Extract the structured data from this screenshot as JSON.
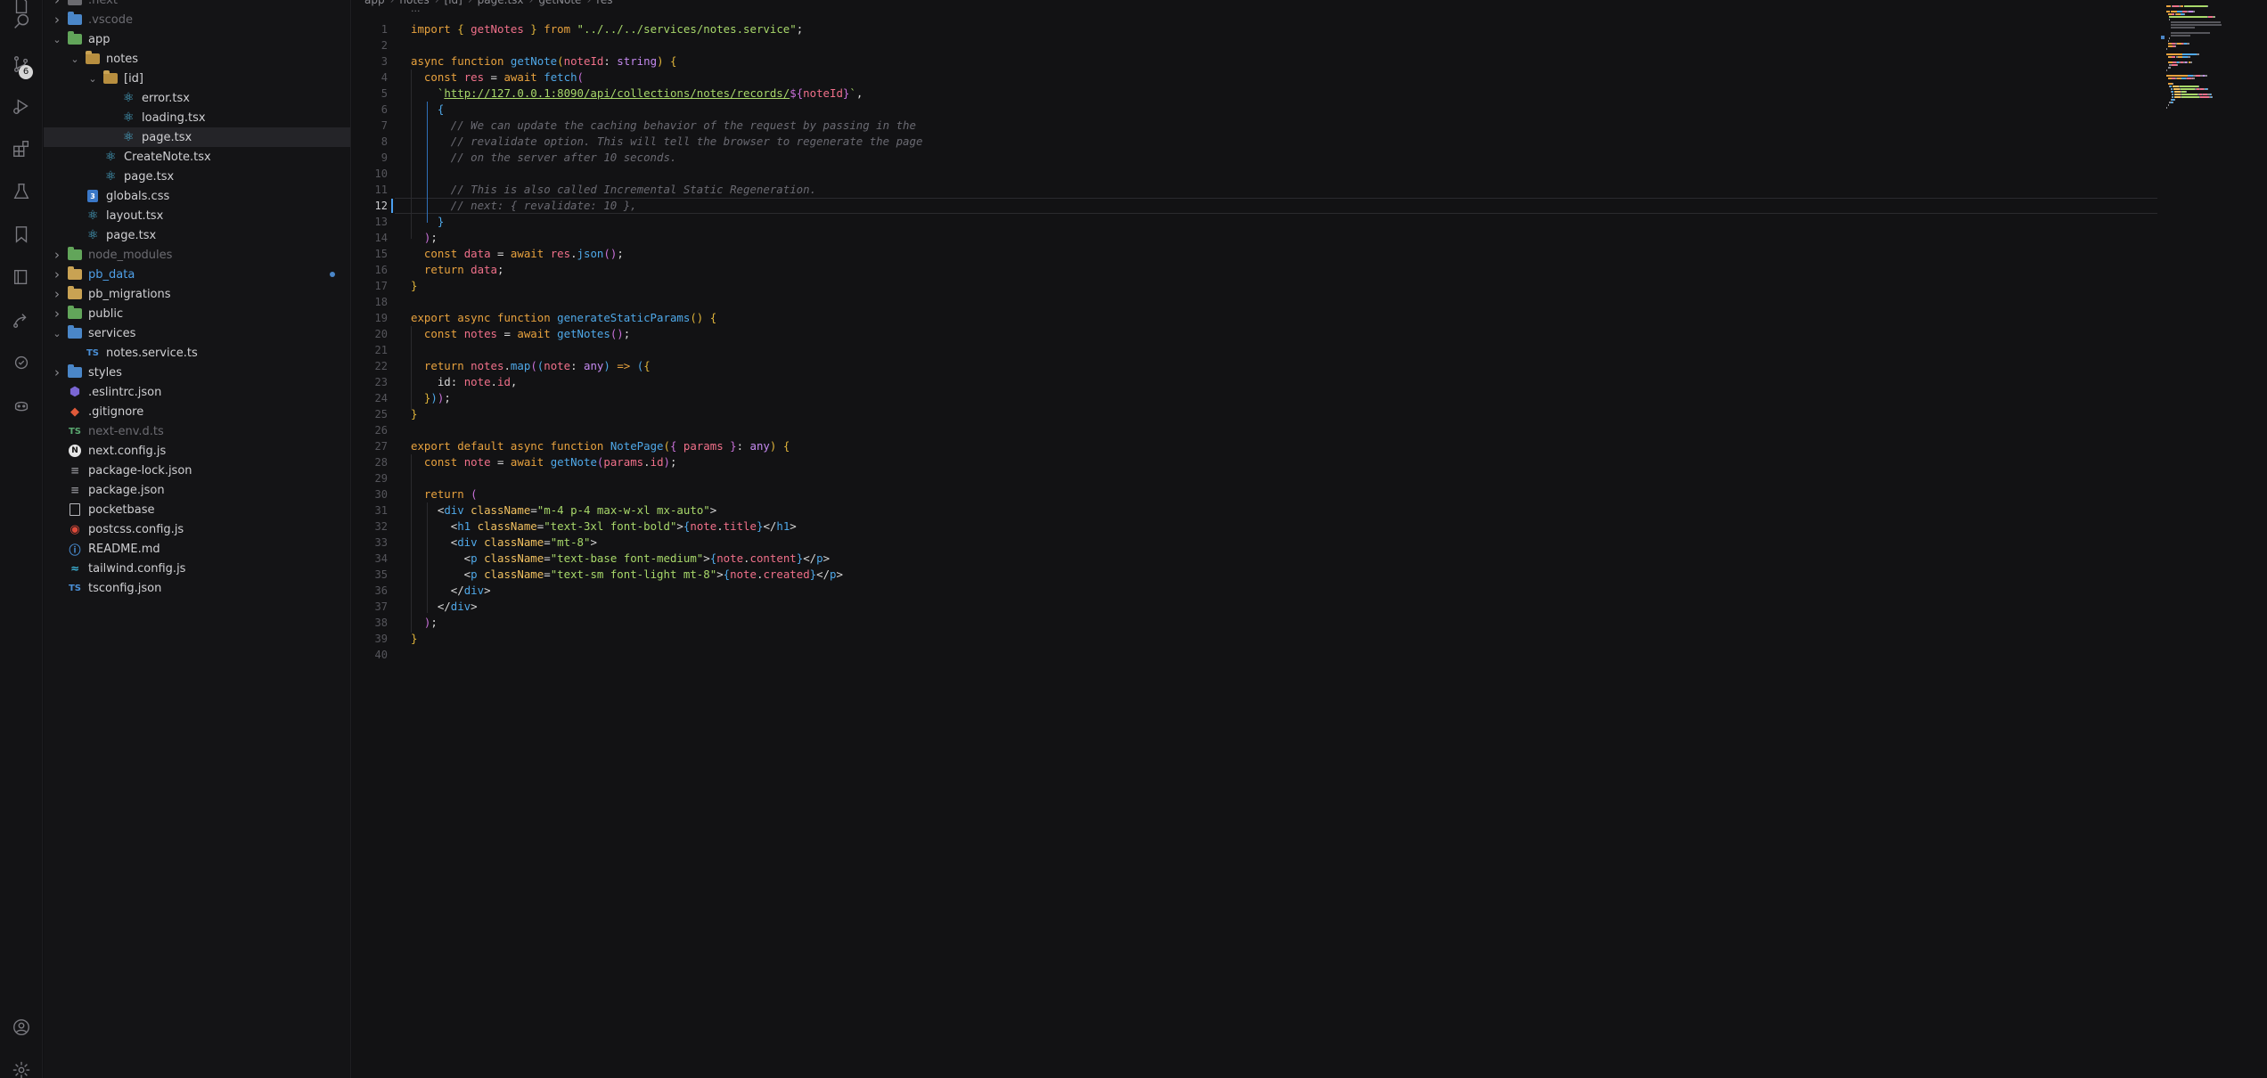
{
  "activity_bar": {
    "items": [
      {
        "name": "files-icon"
      },
      {
        "name": "search-icon"
      },
      {
        "name": "source-control-icon",
        "badge": "6"
      },
      {
        "name": "run-debug-icon"
      },
      {
        "name": "extensions-icon"
      },
      {
        "name": "testing-icon"
      },
      {
        "name": "bookmarks-icon"
      },
      {
        "name": "pages-icon"
      },
      {
        "name": "remote-icon"
      },
      {
        "name": "git-graph-icon"
      },
      {
        "name": "copilot-icon"
      }
    ],
    "bottom": [
      {
        "name": "account-icon"
      },
      {
        "name": "settings-gear-icon"
      }
    ]
  },
  "explorer": {
    "items": [
      {
        "label": ".next",
        "kind": "folder",
        "depth": 1,
        "expanded": false,
        "style": "dim",
        "icon": "folder-grey"
      },
      {
        "label": ".vscode",
        "kind": "folder",
        "depth": 1,
        "expanded": false,
        "style": "dim",
        "icon": "folder-blue"
      },
      {
        "label": "app",
        "kind": "folder",
        "depth": 1,
        "expanded": true,
        "style": "normal",
        "icon": "folder-green"
      },
      {
        "label": "notes",
        "kind": "folder",
        "depth": 2,
        "expanded": true,
        "style": "normal",
        "icon": "folder"
      },
      {
        "label": "[id]",
        "kind": "folder",
        "depth": 3,
        "expanded": true,
        "style": "normal",
        "icon": "folder"
      },
      {
        "label": "error.tsx",
        "kind": "file",
        "depth": 4,
        "style": "normal",
        "icon": "react"
      },
      {
        "label": "loading.tsx",
        "kind": "file",
        "depth": 4,
        "style": "normal",
        "icon": "react"
      },
      {
        "label": "page.tsx",
        "kind": "file",
        "depth": 4,
        "style": "normal",
        "icon": "react",
        "selected": true
      },
      {
        "label": "CreateNote.tsx",
        "kind": "file",
        "depth": 3,
        "style": "normal",
        "icon": "react"
      },
      {
        "label": "page.tsx",
        "kind": "file",
        "depth": 3,
        "style": "normal",
        "icon": "react"
      },
      {
        "label": "globals.css",
        "kind": "file",
        "depth": 2,
        "style": "normal",
        "icon": "css"
      },
      {
        "label": "layout.tsx",
        "kind": "file",
        "depth": 2,
        "style": "normal",
        "icon": "react"
      },
      {
        "label": "page.tsx",
        "kind": "file",
        "depth": 2,
        "style": "normal",
        "icon": "react"
      },
      {
        "label": "node_modules",
        "kind": "folder",
        "depth": 1,
        "expanded": false,
        "style": "dim",
        "icon": "folder-green"
      },
      {
        "label": "pb_data",
        "kind": "folder",
        "depth": 1,
        "expanded": false,
        "style": "blue",
        "icon": "folder",
        "modified": true
      },
      {
        "label": "pb_migrations",
        "kind": "folder",
        "depth": 1,
        "expanded": false,
        "style": "normal",
        "icon": "folder"
      },
      {
        "label": "public",
        "kind": "folder",
        "depth": 1,
        "expanded": false,
        "style": "normal",
        "icon": "folder-green"
      },
      {
        "label": "services",
        "kind": "folder",
        "depth": 1,
        "expanded": true,
        "style": "normal",
        "icon": "folder-blue"
      },
      {
        "label": "notes.service.ts",
        "kind": "file",
        "depth": 2,
        "style": "normal",
        "icon": "ts"
      },
      {
        "label": "styles",
        "kind": "folder",
        "depth": 1,
        "expanded": false,
        "style": "normal",
        "icon": "folder-blue"
      },
      {
        "label": ".eslintrc.json",
        "kind": "file",
        "depth": 1,
        "style": "normal",
        "icon": "eslint"
      },
      {
        "label": ".gitignore",
        "kind": "file",
        "depth": 1,
        "style": "normal",
        "icon": "git"
      },
      {
        "label": "next-env.d.ts",
        "kind": "file",
        "depth": 1,
        "style": "dim",
        "icon": "ts-green"
      },
      {
        "label": "next.config.js",
        "kind": "file",
        "depth": 1,
        "style": "normal",
        "icon": "next"
      },
      {
        "label": "package-lock.json",
        "kind": "file",
        "depth": 1,
        "style": "normal",
        "icon": "lines"
      },
      {
        "label": "package.json",
        "kind": "file",
        "depth": 1,
        "style": "normal",
        "icon": "lines"
      },
      {
        "label": "pocketbase",
        "kind": "file",
        "depth": 1,
        "style": "normal",
        "icon": "file"
      },
      {
        "label": "postcss.config.js",
        "kind": "file",
        "depth": 1,
        "style": "normal",
        "icon": "postcss"
      },
      {
        "label": "README.md",
        "kind": "file",
        "depth": 1,
        "style": "normal",
        "icon": "info"
      },
      {
        "label": "tailwind.config.js",
        "kind": "file",
        "depth": 1,
        "style": "normal",
        "icon": "tailwind"
      },
      {
        "label": "tsconfig.json",
        "kind": "file",
        "depth": 1,
        "style": "normal",
        "icon": "ts"
      }
    ]
  },
  "breadcrumb": [
    "app",
    "notes",
    "[id]",
    "page.tsx",
    "getNote",
    "res"
  ],
  "editor": {
    "active_line": 12,
    "lines": [
      [
        [
          "import",
          "k-imp"
        ],
        [
          " { ",
          "k-br"
        ],
        [
          "getNotes",
          "k-var"
        ],
        [
          " } ",
          "k-br"
        ],
        [
          "from",
          "k-imp"
        ],
        [
          " \"../../../services/notes.service\"",
          "k-str"
        ],
        [
          ";",
          "k-punc"
        ]
      ],
      [],
      [
        [
          "async",
          "k-kw"
        ],
        [
          " function ",
          "k-kw"
        ],
        [
          "getNote",
          "k-fn"
        ],
        [
          "(",
          "k-br"
        ],
        [
          "noteId",
          "k-var"
        ],
        [
          ": ",
          "k-punc"
        ],
        [
          "string",
          "k-type"
        ],
        [
          ") ",
          "k-br"
        ],
        [
          "{",
          "k-br"
        ]
      ],
      [
        [
          "  const ",
          "k-kw"
        ],
        [
          "res",
          "k-var"
        ],
        [
          " = ",
          "k-punc"
        ],
        [
          "await ",
          "k-kw"
        ],
        [
          "fetch",
          "k-fn"
        ],
        [
          "(",
          "k-br2"
        ]
      ],
      [
        [
          "    `",
          "k-str"
        ],
        [
          "http://127.0.0.1:8090/api/collections/notes/records/",
          "k-url"
        ],
        [
          "${",
          "k-br2"
        ],
        [
          "noteId",
          "k-var"
        ],
        [
          "}",
          "k-br2"
        ],
        [
          "`",
          "k-str"
        ],
        [
          ",",
          "k-punc"
        ]
      ],
      [
        [
          "    {",
          "k-br3"
        ]
      ],
      [
        [
          "      // We can update the caching behavior of the request by passing in the",
          "k-com"
        ]
      ],
      [
        [
          "      // revalidate option. This will tell the browser to regenerate the page",
          "k-com"
        ]
      ],
      [
        [
          "      // on the server after 10 seconds.",
          "k-com"
        ]
      ],
      [],
      [
        [
          "      // This is also called Incremental Static Regeneration.",
          "k-com"
        ]
      ],
      [
        [
          "      // next: { revalidate: 10 },",
          "k-com"
        ]
      ],
      [
        [
          "    }",
          "k-br3"
        ]
      ],
      [
        [
          "  )",
          "k-br2"
        ],
        [
          ";",
          "k-punc"
        ]
      ],
      [
        [
          "  const ",
          "k-kw"
        ],
        [
          "data",
          "k-var"
        ],
        [
          " = ",
          "k-punc"
        ],
        [
          "await ",
          "k-kw"
        ],
        [
          "res",
          "k-var"
        ],
        [
          ".",
          "k-punc"
        ],
        [
          "json",
          "k-fn"
        ],
        [
          "()",
          "k-br2"
        ],
        [
          ";",
          "k-punc"
        ]
      ],
      [
        [
          "  return ",
          "k-kw"
        ],
        [
          "data",
          "k-var"
        ],
        [
          ";",
          "k-punc"
        ]
      ],
      [
        [
          "}",
          "k-br"
        ]
      ],
      [],
      [
        [
          "export ",
          "k-kw"
        ],
        [
          "async ",
          "k-kw"
        ],
        [
          "function ",
          "k-kw"
        ],
        [
          "generateStaticParams",
          "k-fn"
        ],
        [
          "() ",
          "k-br"
        ],
        [
          "{",
          "k-br"
        ]
      ],
      [
        [
          "  const ",
          "k-kw"
        ],
        [
          "notes",
          "k-var"
        ],
        [
          " = ",
          "k-punc"
        ],
        [
          "await ",
          "k-kw"
        ],
        [
          "getNotes",
          "k-fn"
        ],
        [
          "()",
          "k-br2"
        ],
        [
          ";",
          "k-punc"
        ]
      ],
      [],
      [
        [
          "  return ",
          "k-kw"
        ],
        [
          "notes",
          "k-var"
        ],
        [
          ".",
          "k-punc"
        ],
        [
          "map",
          "k-fn"
        ],
        [
          "(",
          "k-br2"
        ],
        [
          "(",
          "k-br3"
        ],
        [
          "note",
          "k-var"
        ],
        [
          ": ",
          "k-punc"
        ],
        [
          "any",
          "k-type"
        ],
        [
          ")",
          "k-br3"
        ],
        [
          " => ",
          "k-kw"
        ],
        [
          "(",
          "k-br3"
        ],
        [
          "{",
          "k-br"
        ]
      ],
      [
        [
          "    id",
          "k-punc"
        ],
        [
          ": ",
          "k-punc"
        ],
        [
          "note",
          "k-var"
        ],
        [
          ".",
          "k-punc"
        ],
        [
          "id",
          "k-var"
        ],
        [
          ",",
          "k-punc"
        ]
      ],
      [
        [
          "  }",
          "k-br"
        ],
        [
          ")",
          "k-br3"
        ],
        [
          ")",
          "k-br2"
        ],
        [
          ";",
          "k-punc"
        ]
      ],
      [
        [
          "}",
          "k-br"
        ]
      ],
      [],
      [
        [
          "export ",
          "k-kw"
        ],
        [
          "default ",
          "k-kw"
        ],
        [
          "async ",
          "k-kw"
        ],
        [
          "function ",
          "k-kw"
        ],
        [
          "NotePage",
          "k-fn"
        ],
        [
          "(",
          "k-br"
        ],
        [
          "{ ",
          "k-br2"
        ],
        [
          "params",
          "k-var"
        ],
        [
          " }",
          "k-br2"
        ],
        [
          ": ",
          "k-punc"
        ],
        [
          "any",
          "k-type"
        ],
        [
          ") ",
          "k-br"
        ],
        [
          "{",
          "k-br"
        ]
      ],
      [
        [
          "  const ",
          "k-kw"
        ],
        [
          "note",
          "k-var"
        ],
        [
          " = ",
          "k-punc"
        ],
        [
          "await ",
          "k-kw"
        ],
        [
          "getNote",
          "k-fn"
        ],
        [
          "(",
          "k-br2"
        ],
        [
          "params",
          "k-var"
        ],
        [
          ".",
          "k-punc"
        ],
        [
          "id",
          "k-var"
        ],
        [
          ")",
          "k-br2"
        ],
        [
          ";",
          "k-punc"
        ]
      ],
      [],
      [
        [
          "  return ",
          "k-kw"
        ],
        [
          "(",
          "k-br2"
        ]
      ],
      [
        [
          "    <",
          "k-punc"
        ],
        [
          "div",
          "k-tag"
        ],
        [
          " className",
          "k-attr"
        ],
        [
          "=",
          "k-punc"
        ],
        [
          "\"m-4 p-4 max-w-xl mx-auto\"",
          "k-str"
        ],
        [
          ">",
          "k-punc"
        ]
      ],
      [
        [
          "      <",
          "k-punc"
        ],
        [
          "h1",
          "k-tag"
        ],
        [
          " className",
          "k-attr"
        ],
        [
          "=",
          "k-punc"
        ],
        [
          "\"text-3xl font-bold\"",
          "k-str"
        ],
        [
          ">",
          "k-punc"
        ],
        [
          "{",
          "k-br3"
        ],
        [
          "note",
          "k-var"
        ],
        [
          ".",
          "k-punc"
        ],
        [
          "title",
          "k-prop"
        ],
        [
          "}",
          "k-br3"
        ],
        [
          "</",
          "k-punc"
        ],
        [
          "h1",
          "k-tag"
        ],
        [
          ">",
          "k-punc"
        ]
      ],
      [
        [
          "      <",
          "k-punc"
        ],
        [
          "div",
          "k-tag"
        ],
        [
          " className",
          "k-attr"
        ],
        [
          "=",
          "k-punc"
        ],
        [
          "\"mt-8\"",
          "k-str"
        ],
        [
          ">",
          "k-punc"
        ]
      ],
      [
        [
          "        <",
          "k-punc"
        ],
        [
          "p",
          "k-tag"
        ],
        [
          " className",
          "k-attr"
        ],
        [
          "=",
          "k-punc"
        ],
        [
          "\"text-base font-medium\"",
          "k-str"
        ],
        [
          ">",
          "k-punc"
        ],
        [
          "{",
          "k-br3"
        ],
        [
          "note",
          "k-var"
        ],
        [
          ".",
          "k-punc"
        ],
        [
          "content",
          "k-prop"
        ],
        [
          "}",
          "k-br3"
        ],
        [
          "</",
          "k-punc"
        ],
        [
          "p",
          "k-tag"
        ],
        [
          ">",
          "k-punc"
        ]
      ],
      [
        [
          "        <",
          "k-punc"
        ],
        [
          "p",
          "k-tag"
        ],
        [
          " className",
          "k-attr"
        ],
        [
          "=",
          "k-punc"
        ],
        [
          "\"text-sm font-light mt-8\"",
          "k-str"
        ],
        [
          ">",
          "k-punc"
        ],
        [
          "{",
          "k-br3"
        ],
        [
          "note",
          "k-var"
        ],
        [
          ".",
          "k-punc"
        ],
        [
          "created",
          "k-prop"
        ],
        [
          "}",
          "k-br3"
        ],
        [
          "</",
          "k-punc"
        ],
        [
          "p",
          "k-tag"
        ],
        [
          ">",
          "k-punc"
        ]
      ],
      [
        [
          "      </",
          "k-punc"
        ],
        [
          "div",
          "k-tag"
        ],
        [
          ">",
          "k-punc"
        ]
      ],
      [
        [
          "    </",
          "k-punc"
        ],
        [
          "div",
          "k-tag"
        ],
        [
          ">",
          "k-punc"
        ]
      ],
      [
        [
          "  )",
          "k-br2"
        ],
        [
          ";",
          "k-punc"
        ]
      ],
      [
        [
          "}",
          "k-br"
        ]
      ],
      []
    ]
  }
}
